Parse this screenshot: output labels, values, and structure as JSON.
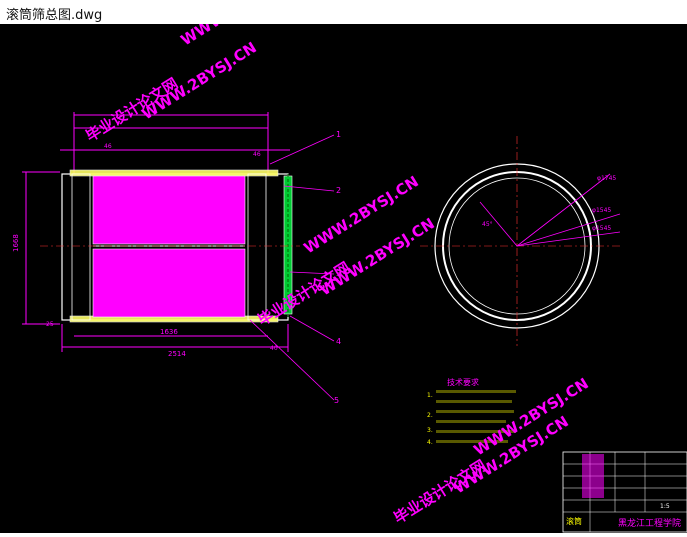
{
  "window": {
    "title": "滚筒筛总图.dwg"
  },
  "colors": {
    "background": "#000000",
    "dim": "#ff00ff",
    "line": "#ffffff",
    "accent": "#00ff00",
    "yellow": "#ffff00",
    "watermark": "#ff00ff"
  },
  "watermarks": {
    "site": "WWW.2BYSJ.CN",
    "name": "毕业设计论文网"
  },
  "drawing": {
    "callouts": [
      "1",
      "2",
      "3",
      "4",
      "5"
    ],
    "dims": {
      "overall_height": "1668",
      "inner_length": "1636",
      "total_length": "2514",
      "d1": "46",
      "d2": "46",
      "d3": "25",
      "d4": "25",
      "d5": "30",
      "d6": "40",
      "circle_r1": "φ1745",
      "circle_r2": "φ1545",
      "circle_r3": "φ1545",
      "angle": "45°"
    },
    "tech_title": "技术要求",
    "tech_notes": [
      "1.",
      "2.",
      "3.",
      "4."
    ],
    "title_block": {
      "name": "滚筒",
      "school": "黑龙江工程学院",
      "scale": "1:5"
    }
  }
}
